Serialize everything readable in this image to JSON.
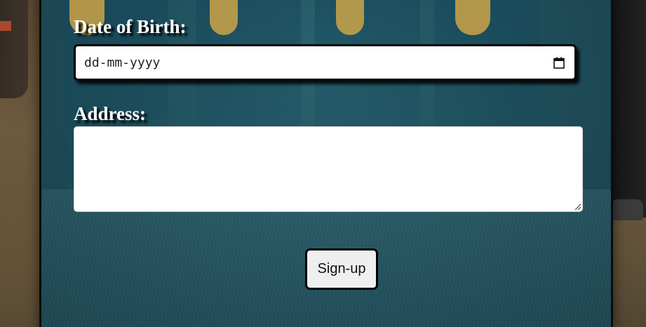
{
  "form": {
    "dob_label": "Date of Birth:",
    "dob_placeholder": "dd-mm-yyyy",
    "address_label": "Address:",
    "address_value": "",
    "submit_label": "Sign-up"
  },
  "icons": {
    "date_picker": "calendar-icon",
    "textarea_resize": "resize-grip-icon"
  },
  "colors": {
    "panel": "#1f5a6a",
    "label_text": "#ffffff",
    "button_bg": "#efefef",
    "border": "#000000"
  }
}
